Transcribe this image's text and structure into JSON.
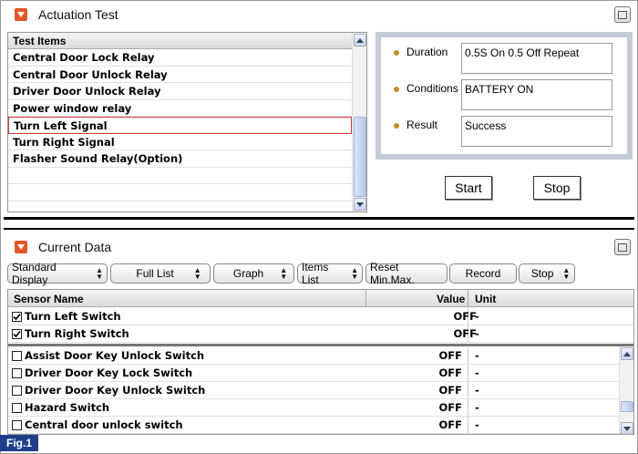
{
  "actuation": {
    "title": "Actuation Test",
    "list_header": "Test Items",
    "items": [
      "Central Door Lock Relay",
      "Central Door Unlock Relay",
      "Driver Door Unlock Relay",
      "Power window relay",
      "Turn Left Signal",
      "Turn Right Signal",
      "Flasher Sound Relay(Option)",
      "",
      ""
    ],
    "selected_index": 4,
    "info": {
      "duration_label": "Duration",
      "duration_value": "0.5S On 0.5 Off Repeat",
      "conditions_label": "Conditions",
      "conditions_value": "BATTERY ON",
      "result_label": "Result",
      "result_value": "Success"
    },
    "start_label": "Start",
    "stop_label": "Stop"
  },
  "current_data": {
    "title": "Current Data",
    "toolbar": {
      "standard_display": "Standard Display",
      "full_list": "Full List",
      "graph": "Graph",
      "items_list": "Items List",
      "reset_min_max": "Reset Min.Max.",
      "record": "Record",
      "stop": "Stop"
    },
    "columns": {
      "sensor_name": "Sensor Name",
      "value": "Value",
      "unit": "Unit"
    },
    "fixed_rows": [
      {
        "name": "Turn Left Switch",
        "value": "OFF",
        "unit": "-",
        "checked": true
      },
      {
        "name": "Turn Right Switch",
        "value": "OFF",
        "unit": "-",
        "checked": true
      }
    ],
    "rows": [
      {
        "name": "Assist Door Key Unlock Switch",
        "value": "OFF",
        "unit": "-",
        "checked": false
      },
      {
        "name": "Driver Door Key Lock Switch",
        "value": "OFF",
        "unit": "-",
        "checked": false
      },
      {
        "name": "Driver Door Key Unlock Switch",
        "value": "OFF",
        "unit": "-",
        "checked": false
      },
      {
        "name": "Hazard Switch",
        "value": "OFF",
        "unit": "-",
        "checked": false
      },
      {
        "name": "Central door unlock switch",
        "value": "OFF",
        "unit": "-",
        "checked": false
      }
    ]
  },
  "figure_label": "Fig.1",
  "colors": {
    "accent": "#e0562a",
    "selection_border": "#d23a3a",
    "info_panel_bg": "#c3cbd8",
    "bullet": "#c88a2c",
    "fig_label_bg": "#1d3f8a"
  }
}
